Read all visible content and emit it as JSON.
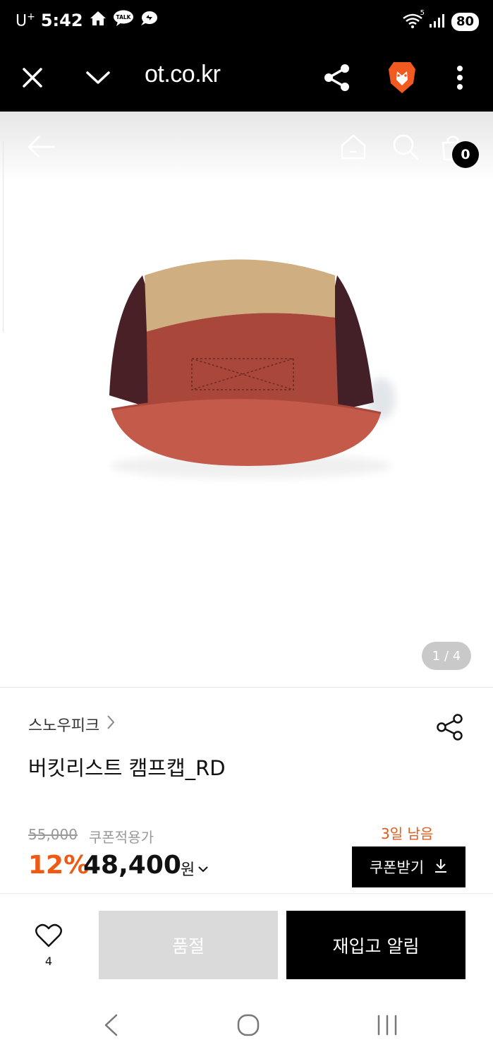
{
  "status_bar": {
    "carrier": "U",
    "carrier_sup": "+",
    "time": "5:42",
    "talk_label": "TALK",
    "network_label": "5",
    "battery": "80"
  },
  "browser": {
    "url": "ot.co.kr",
    "icons": [
      "close-icon",
      "chevron-down-icon",
      "share-icon",
      "brave-lion-icon",
      "more-vert-icon"
    ]
  },
  "site_header": {
    "icons": [
      "back-arrow-icon",
      "home-icon",
      "search-icon",
      "cart-icon"
    ],
    "cart_count": "0"
  },
  "gallery": {
    "page_indicator": "1 / 4",
    "colors": {
      "crown_top": "#cfae82",
      "front_panel": "#a9473a",
      "side_panel": "#4a2027",
      "brim": "#c45a4a"
    }
  },
  "product": {
    "brand": "스노우피크",
    "title": "버킷리스트 캠프캡_RD",
    "original_price": "55,000",
    "coupon_label": "쿠폰적용가",
    "days_left": "3일 남음",
    "discount": "12%",
    "price": "48,400",
    "currency": "원",
    "coupon_button": "쿠폰받기"
  },
  "actions": {
    "wish_count": "4",
    "soldout_label": "품절",
    "restock_label": "재입고 알림"
  },
  "navigation": {
    "icons": [
      "nav-back-icon",
      "nav-home-icon",
      "nav-recents-icon"
    ]
  },
  "colors": {
    "accent": "#ee5a14",
    "days_left": "#e25a1c",
    "soldout_bg": "#dadada",
    "dark": "#000000"
  }
}
